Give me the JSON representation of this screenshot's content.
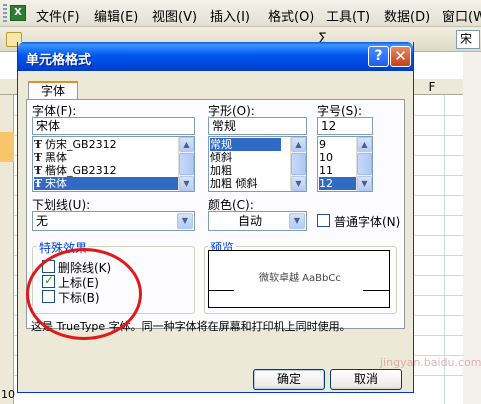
{
  "menubar": {
    "items": [
      "文件(F)",
      "编辑(E)",
      "视图(V)",
      "插入(I)",
      "格式(O)",
      "工具(T)",
      "数据(D)",
      "窗口(W)"
    ]
  },
  "toolbar": {
    "sigma": "Σ",
    "font_box_label": "宋"
  },
  "sheet": {
    "col_label": "F",
    "row_label": "10"
  },
  "dialog": {
    "title": "单元格格式",
    "help_label": "?",
    "close_label": "✕",
    "tab_label": "字体",
    "font": {
      "label": "字体(F):",
      "value": "宋体",
      "items": [
        {
          "text": "仿宋_GB2312",
          "selected": false
        },
        {
          "text": "黑体",
          "selected": false
        },
        {
          "text": "楷体_GB2312",
          "selected": false
        },
        {
          "text": "宋体",
          "selected": true
        }
      ]
    },
    "style": {
      "label": "字形(O):",
      "value": "常规",
      "items": [
        {
          "text": "常规",
          "selected": true
        },
        {
          "text": "倾斜",
          "selected": false
        },
        {
          "text": "加粗",
          "selected": false
        },
        {
          "text": "加粗 倾斜",
          "selected": false
        }
      ]
    },
    "size": {
      "label": "字号(S):",
      "value": "12",
      "items": [
        {
          "text": "9",
          "selected": false
        },
        {
          "text": "10",
          "selected": false
        },
        {
          "text": "11",
          "selected": false
        },
        {
          "text": "12",
          "selected": true
        }
      ]
    },
    "underline": {
      "label": "下划线(U):",
      "value": "无"
    },
    "color": {
      "label": "颜色(C):",
      "value": "自动"
    },
    "normal_font": {
      "label": "普通字体(N)",
      "checked": false
    },
    "effects": {
      "title": "特殊效果",
      "strikethrough": {
        "label": "删除线(K)",
        "checked": false
      },
      "superscript": {
        "label": "上标(E)",
        "checked": true
      },
      "subscript": {
        "label": "下标(B)",
        "checked": false
      }
    },
    "preview": {
      "title": "预览",
      "sample": "微软卓越  AaBbCc"
    },
    "info": "这是 TrueType 字体。同一种字体将在屏幕和打印机上同时使用。",
    "ok_label": "确定",
    "cancel_label": "取消"
  },
  "watermark": "jingyan.baidu.com",
  "colors": {
    "titlebar": "#0058ee",
    "selection": "#316ac5",
    "annotation_circle": "#e01818",
    "group_title": "#0046d5"
  }
}
